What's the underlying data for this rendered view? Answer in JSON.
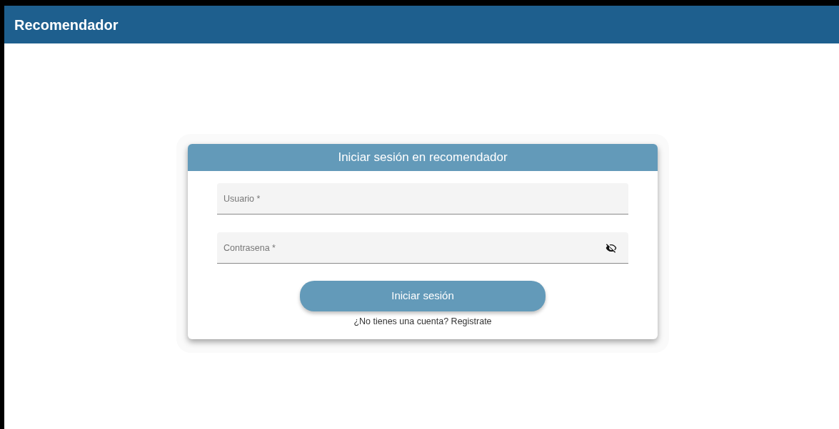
{
  "app_bar": {
    "title": "Recomendador"
  },
  "login_card": {
    "title": "Iniciar sesión en recomendador",
    "fields": [
      {
        "kind": "text",
        "placeholder": "Usuario *"
      },
      {
        "kind": "password",
        "placeholder": "Contrasena *"
      }
    ],
    "submit_button": "Iniciar sesión",
    "register_link": "¿No tienes una cuenta? Registrate"
  }
}
